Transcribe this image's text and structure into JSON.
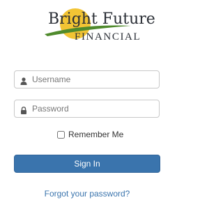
{
  "brand": {
    "line1": "Bright Future",
    "line2": "FINANCIAL",
    "sun_color": "#f2c434",
    "swoosh_color": "#4f8a2c"
  },
  "login": {
    "username": {
      "icon": "user-icon",
      "placeholder": "Username",
      "value": ""
    },
    "password": {
      "icon": "lock-icon",
      "placeholder": "Password",
      "value": ""
    },
    "remember_me": {
      "label": "Remember Me",
      "checked": false
    },
    "submit_label": "Sign In",
    "forgot_label": "Forgot your password?"
  },
  "colors": {
    "primary_button": "#3a74ad",
    "link": "#3a74ad",
    "input_border": "#c8c8c8"
  }
}
